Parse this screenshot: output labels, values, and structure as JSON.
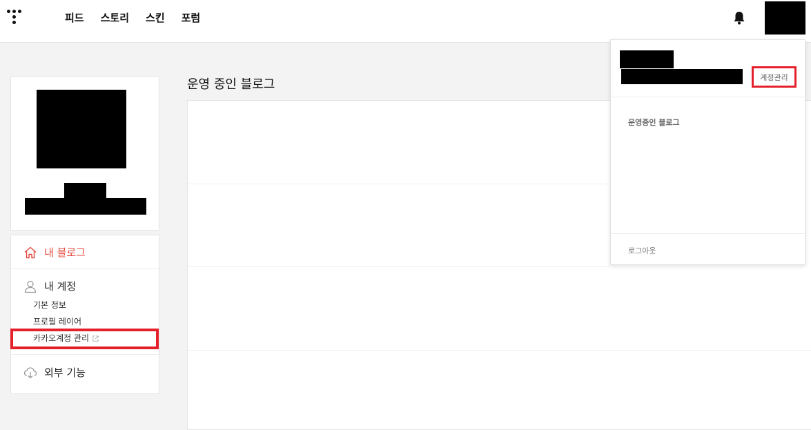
{
  "header": {
    "nav": [
      "피드",
      "스토리",
      "스킨",
      "포럼"
    ],
    "icons": [
      "tistory-logo-icon",
      "bell-icon"
    ]
  },
  "sidebar": {
    "menu": {
      "my_blog": "내 블로그",
      "my_account": "내 계정",
      "sub_items": [
        "기본 정보",
        "프로필 레이어",
        "카카오계정 관리"
      ],
      "external": "외부 기능"
    },
    "active_color": "#e4473b"
  },
  "main": {
    "title": "운영 중인 블로그"
  },
  "dropdown": {
    "manage_account": "계정관리",
    "section_label": "운영중인 블로그",
    "logout": "로그아웃"
  },
  "colors": {
    "highlight": "#e4202a",
    "accent": "#e4473b"
  }
}
